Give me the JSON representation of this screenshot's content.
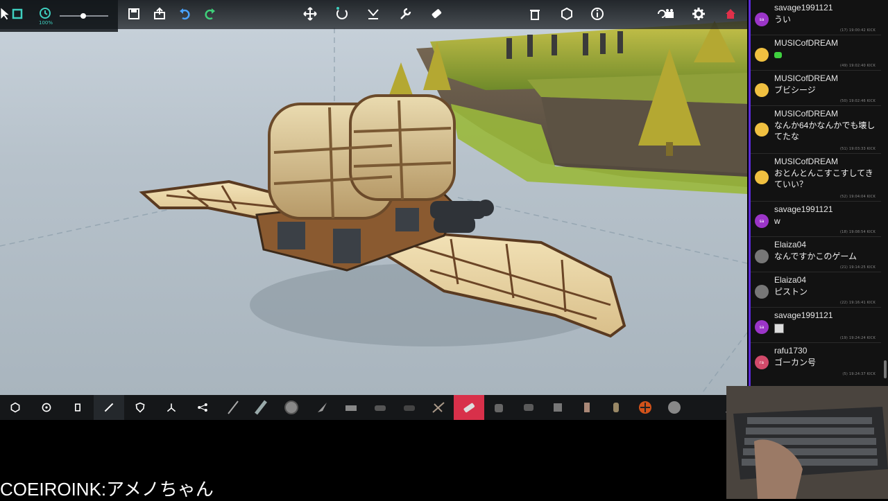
{
  "topbar": {
    "left_icons": [
      "cursor-icon",
      "square-select-icon"
    ],
    "time_scale": {
      "value_label": "100%",
      "slider_fraction": 0.48
    },
    "file_icons": [
      "save-icon",
      "load-icon",
      "undo-icon",
      "redo-icon"
    ],
    "tool_icons": [
      "move-icon",
      "rotate-icon",
      "mirror-icon",
      "wrench-icon",
      "eraser-icon"
    ],
    "right_icons": [
      "trash-icon",
      "hexagon-icon",
      "info-icon",
      "camera-switch-icon",
      "settings-icon",
      "home-icon"
    ]
  },
  "bottombar": {
    "categories": [
      "basic-icon",
      "wheel-icon",
      "mechanical-icon",
      "weapon-icon",
      "armour-icon",
      "flight-icon",
      "automation-icon"
    ],
    "active_category_index": 3,
    "blocks": [
      "spike-block",
      "blade-block",
      "circular-saw-block",
      "drill-block",
      "spike-ball-block",
      "cannon-block",
      "shrapnel-cannon-block",
      "crossbow-block",
      "flamethrower-block",
      "vacuum-block",
      "water-cannon-block",
      "torch-block",
      "bomb-block",
      "grenade-block",
      "rocket-block",
      "fire-ball-block",
      "boulder-block"
    ],
    "active_block_index": 7,
    "search_icon": "search-icon"
  },
  "subtitle": {
    "text": "COEIROINK:アメノちゃん"
  },
  "chat": {
    "accent": "#5b2bd8",
    "messages": [
      {
        "user": "savage1991121",
        "text": "うい",
        "meta": "(17)  19:00:42  KICK",
        "avatar": "sa",
        "avatar_color": "#9b35c8"
      },
      {
        "user": "MUSICofDREAM",
        "text": "",
        "emote": true,
        "meta": "(49)  19:02:40  KICK",
        "avatar": "",
        "avatar_color": "#f0c040"
      },
      {
        "user": "MUSICofDREAM",
        "text": "ブビシージ",
        "meta": "(50)  19:02:46  KICK",
        "avatar": "",
        "avatar_color": "#f0c040"
      },
      {
        "user": "MUSICofDREAM",
        "text": "なんか64かなんかでも壊してたな",
        "meta": "(51)  19:03:33  KICK",
        "avatar": "",
        "avatar_color": "#f0c040"
      },
      {
        "user": "MUSICofDREAM",
        "text": "おとんとんこすこすしてきていい？",
        "meta": "(52)  19:04:04  KICK",
        "avatar": "",
        "avatar_color": "#f0c040"
      },
      {
        "user": "savage1991121",
        "text": "w",
        "meta": "(18)  19:08:54  KICK",
        "avatar": "sa",
        "avatar_color": "#9b35c8"
      },
      {
        "user": "Elaiza04",
        "text": "なんですかこのゲーム",
        "meta": "(21)  19:14:25  KICK",
        "avatar": "",
        "avatar_color": "#777777"
      },
      {
        "user": "Elaiza04",
        "text": "ピストン",
        "meta": "(22)  19:16:41  KICK",
        "avatar": "",
        "avatar_color": "#777777"
      },
      {
        "user": "savage1991121",
        "text": "",
        "image": true,
        "meta": "(19)  19:24:24  KICK",
        "avatar": "sa",
        "avatar_color": "#9b35c8"
      },
      {
        "user": "rafu1730",
        "text": "ゴーカン号",
        "meta": "(5)  19:24:37  KICK",
        "avatar": "ra",
        "avatar_color": "#d24a6a"
      }
    ]
  }
}
